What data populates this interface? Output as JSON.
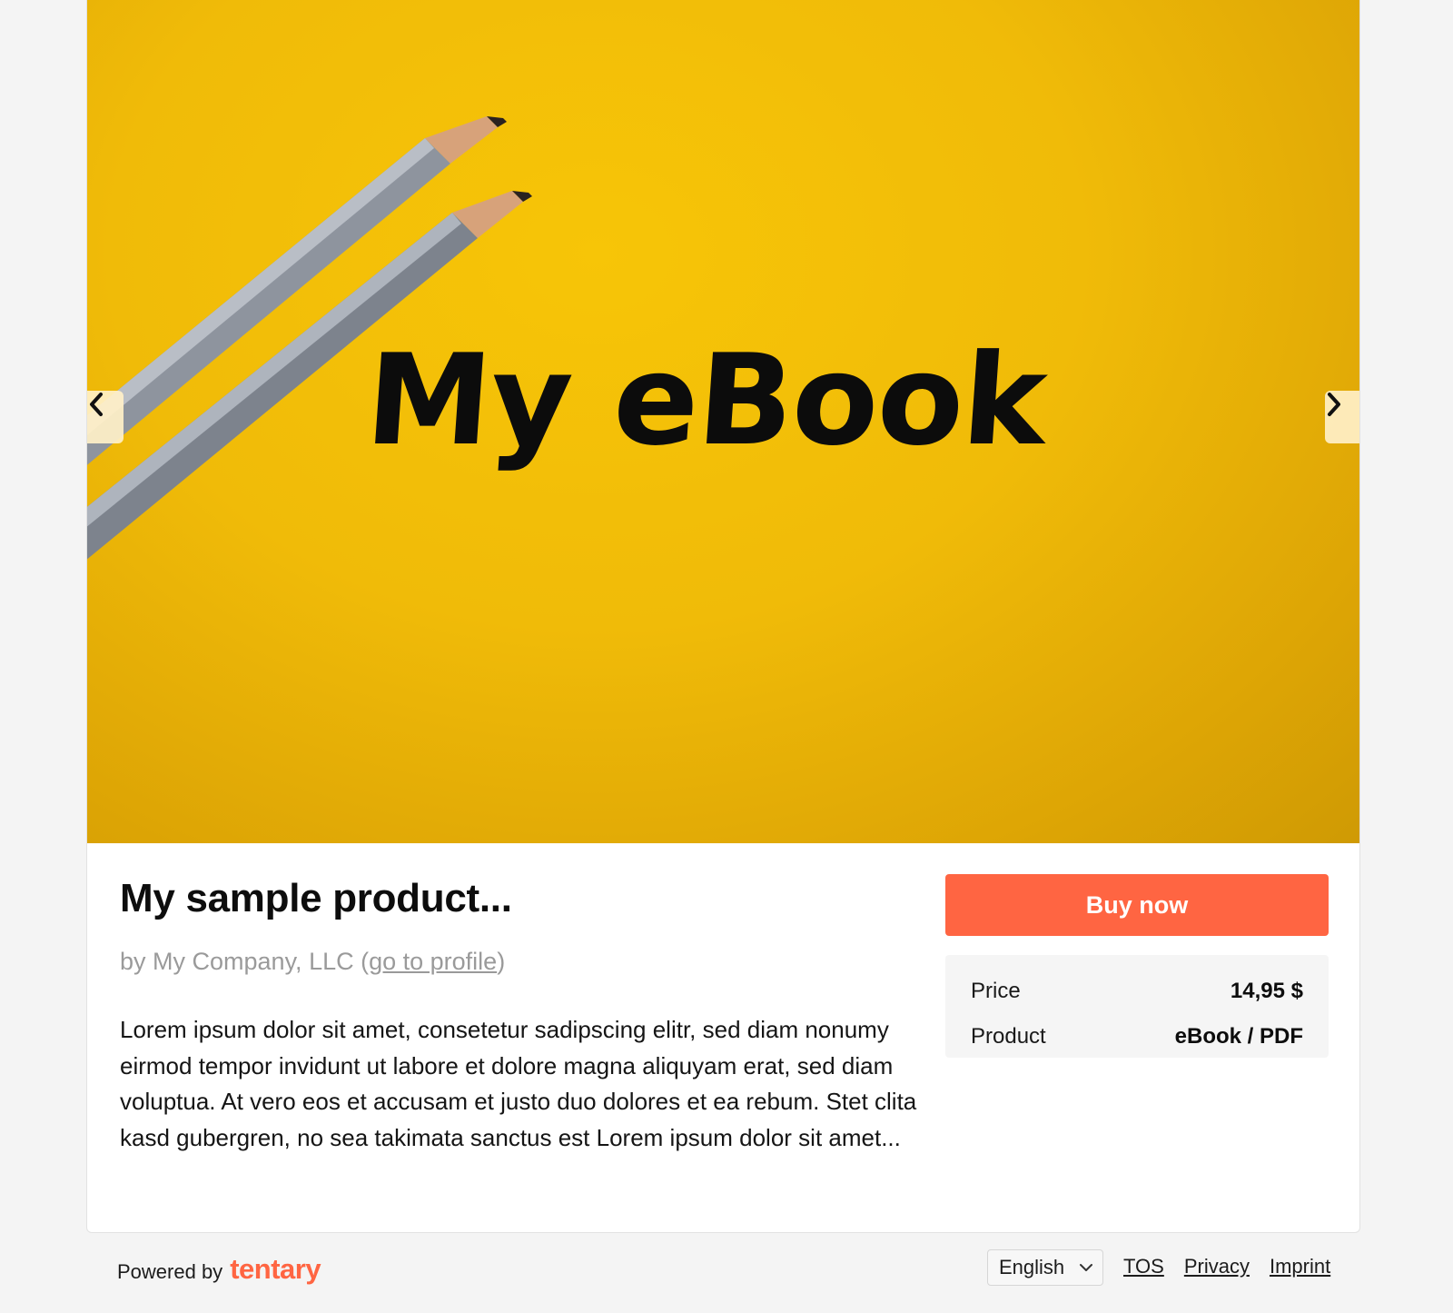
{
  "hero": {
    "image_text": "My eBook",
    "prev_icon": "chevron-left-icon",
    "next_icon": "chevron-right-icon"
  },
  "product": {
    "title": "My sample product...",
    "by_prefix": "by My Company, LLC (",
    "profile_link": "go to profile",
    "by_suffix": ")",
    "description": "Lorem ipsum dolor sit amet, consetetur sadipscing elitr, sed diam nonumy eirmod tempor invidunt ut labore et dolore magna aliquyam erat, sed diam voluptua. At vero eos et accusam et justo duo dolores et ea rebum. Stet clita kasd gubergren, no sea takimata sanctus est Lorem ipsum dolor sit amet..."
  },
  "purchase": {
    "buy_label": "Buy now",
    "price_label": "Price",
    "price_value": "14,95 $",
    "product_label": "Product",
    "product_value": "eBook / PDF"
  },
  "footer": {
    "powered_by": "Powered by",
    "brand": "tentary",
    "language": "English",
    "links": [
      "TOS",
      "Privacy",
      "Imprint"
    ]
  },
  "colors": {
    "accent": "#ff6542",
    "hero_background": "#f0bb08"
  }
}
